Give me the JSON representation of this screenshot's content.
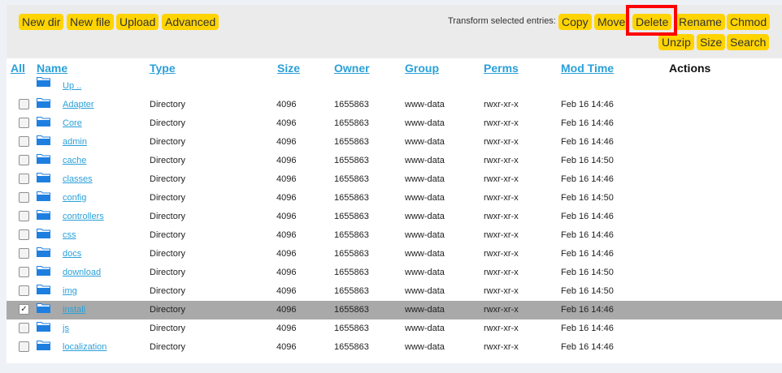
{
  "toolbar": {
    "new_dir": "New dir",
    "new_file": "New file",
    "upload": "Upload",
    "advanced": "Advanced",
    "transform_label": "Transform selected entries:",
    "copy": "Copy",
    "move": "Move",
    "delete": "Delete",
    "rename": "Rename",
    "chmod": "Chmod",
    "unzip": "Unzip",
    "size": "Size",
    "search": "Search"
  },
  "columns": {
    "all": "All",
    "name": "Name",
    "type": "Type",
    "size": "Size",
    "owner": "Owner",
    "group": "Group",
    "perms": "Perms",
    "mod_time": "Mod Time",
    "actions": "Actions"
  },
  "up_link": "Up ..",
  "rows": [
    {
      "name": "Adapter",
      "type": "Directory",
      "size": "4096",
      "owner": "1655863",
      "group": "www-data",
      "perms": "rwxr-xr-x",
      "mtime": "Feb 16 14:46",
      "checked": false
    },
    {
      "name": "Core",
      "type": "Directory",
      "size": "4096",
      "owner": "1655863",
      "group": "www-data",
      "perms": "rwxr-xr-x",
      "mtime": "Feb 16 14:46",
      "checked": false
    },
    {
      "name": "admin",
      "type": "Directory",
      "size": "4096",
      "owner": "1655863",
      "group": "www-data",
      "perms": "rwxr-xr-x",
      "mtime": "Feb 16 14:46",
      "checked": false
    },
    {
      "name": "cache",
      "type": "Directory",
      "size": "4096",
      "owner": "1655863",
      "group": "www-data",
      "perms": "rwxr-xr-x",
      "mtime": "Feb 16 14:50",
      "checked": false
    },
    {
      "name": "classes",
      "type": "Directory",
      "size": "4096",
      "owner": "1655863",
      "group": "www-data",
      "perms": "rwxr-xr-x",
      "mtime": "Feb 16 14:46",
      "checked": false
    },
    {
      "name": "config",
      "type": "Directory",
      "size": "4096",
      "owner": "1655863",
      "group": "www-data",
      "perms": "rwxr-xr-x",
      "mtime": "Feb 16 14:50",
      "checked": false
    },
    {
      "name": "controllers",
      "type": "Directory",
      "size": "4096",
      "owner": "1655863",
      "group": "www-data",
      "perms": "rwxr-xr-x",
      "mtime": "Feb 16 14:46",
      "checked": false
    },
    {
      "name": "css",
      "type": "Directory",
      "size": "4096",
      "owner": "1655863",
      "group": "www-data",
      "perms": "rwxr-xr-x",
      "mtime": "Feb 16 14:46",
      "checked": false
    },
    {
      "name": "docs",
      "type": "Directory",
      "size": "4096",
      "owner": "1655863",
      "group": "www-data",
      "perms": "rwxr-xr-x",
      "mtime": "Feb 16 14:46",
      "checked": false
    },
    {
      "name": "download",
      "type": "Directory",
      "size": "4096",
      "owner": "1655863",
      "group": "www-data",
      "perms": "rwxr-xr-x",
      "mtime": "Feb 16 14:50",
      "checked": false
    },
    {
      "name": "img",
      "type": "Directory",
      "size": "4096",
      "owner": "1655863",
      "group": "www-data",
      "perms": "rwxr-xr-x",
      "mtime": "Feb 16 14:50",
      "checked": false
    },
    {
      "name": "install",
      "type": "Directory",
      "size": "4096",
      "owner": "1655863",
      "group": "www-data",
      "perms": "rwxr-xr-x",
      "mtime": "Feb 16 14:46",
      "checked": true
    },
    {
      "name": "js",
      "type": "Directory",
      "size": "4096",
      "owner": "1655863",
      "group": "www-data",
      "perms": "rwxr-xr-x",
      "mtime": "Feb 16 14:46",
      "checked": false
    },
    {
      "name": "localization",
      "type": "Directory",
      "size": "4096",
      "owner": "1655863",
      "group": "www-data",
      "perms": "rwxr-xr-x",
      "mtime": "Feb 16 14:46",
      "checked": false
    }
  ],
  "colors": {
    "button_bg": "#ffd400",
    "link": "#2aa0d8",
    "selected_row": "#a9a9a9",
    "highlight": "#ff0000",
    "folder_icon": "#1e7fe0"
  },
  "icons": {
    "folder": "folder-icon",
    "check": "✓"
  }
}
